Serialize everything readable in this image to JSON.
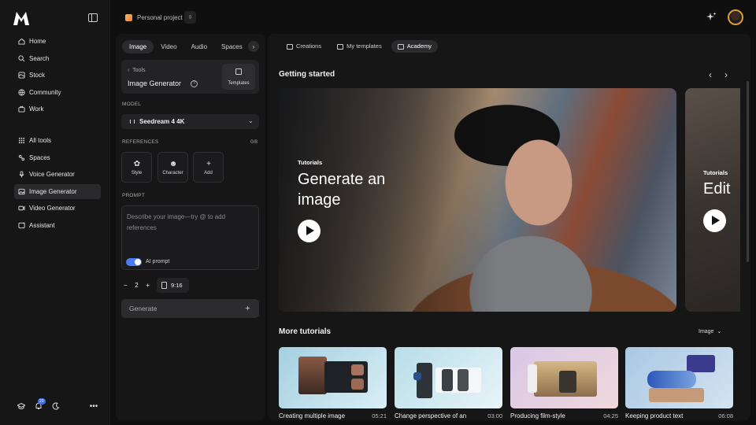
{
  "nav": {
    "primary": [
      {
        "label": "Home",
        "icon": "home-icon"
      },
      {
        "label": "Search",
        "icon": "search-icon"
      },
      {
        "label": "Stock",
        "icon": "stock-icon"
      },
      {
        "label": "Community",
        "icon": "globe-icon"
      },
      {
        "label": "Work",
        "icon": "briefcase-icon"
      }
    ],
    "tools": [
      {
        "label": "All tools",
        "icon": "grid-icon"
      },
      {
        "label": "Spaces",
        "icon": "spaces-icon"
      },
      {
        "label": "Voice Generator",
        "icon": "mic-icon"
      },
      {
        "label": "Image Generator",
        "icon": "image-icon",
        "active": true
      },
      {
        "label": "Video Generator",
        "icon": "video-icon"
      },
      {
        "label": "Assistant",
        "icon": "assistant-icon"
      }
    ],
    "notification_count": "20"
  },
  "topbar": {
    "project_name": "Personal project",
    "accent": "#e09a3a"
  },
  "tools_panel": {
    "tabs": [
      "Image",
      "Video",
      "Audio",
      "Spaces"
    ],
    "active_tab": "Image",
    "back_label": "Tools",
    "tool_title": "Image Generator",
    "templates_label": "Templates",
    "model_label": "MODEL",
    "model_value": "Seedream 4 4K",
    "references_label": "REFERENCES",
    "references_count": "0/8",
    "reference_buttons": [
      "Style",
      "Character",
      "Add"
    ],
    "prompt_label": "PROMPT",
    "prompt_placeholder": "Describe your image—try @ to add references",
    "ai_prompt_label": "AI prompt",
    "ai_prompt_on": true,
    "quantity": "2",
    "ratio": "9:16",
    "generate_label": "Generate"
  },
  "main": {
    "tabs": [
      "Creations",
      "My templates",
      "Academy"
    ],
    "active_tab": "Academy",
    "getting_started_title": "Getting started",
    "hero": {
      "kicker": "Tutorials",
      "title": "Generate an image"
    },
    "hero_next": {
      "kicker": "Tutorials",
      "title": "Edit"
    },
    "more_title": "More tutorials",
    "filter_label": "Image",
    "cards": [
      {
        "title": "Creating multiple image",
        "duration": "05:21"
      },
      {
        "title": "Change perspective of an",
        "duration": "03:00"
      },
      {
        "title": "Producing film-style",
        "duration": "04:25"
      },
      {
        "title": "Keeping product text",
        "duration": "06:08"
      }
    ]
  }
}
